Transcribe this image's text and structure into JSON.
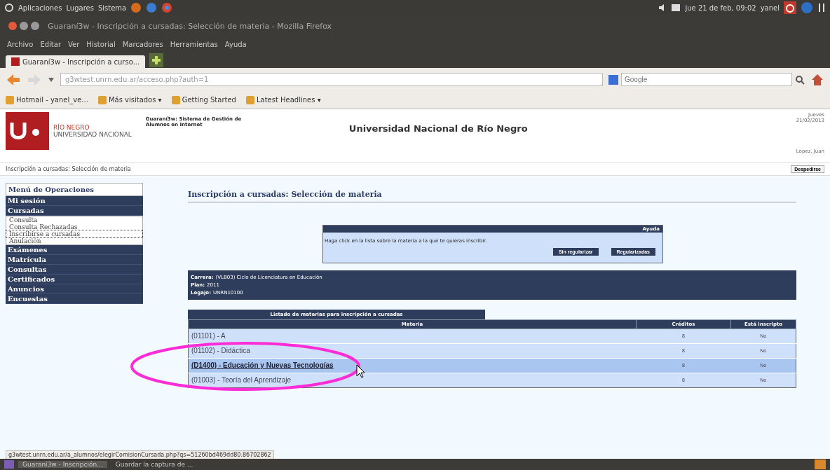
{
  "top_panel": {
    "menus": [
      "Aplicaciones",
      "Lugares",
      "Sistema"
    ],
    "datetime": "jue 21 de feb, 09:02",
    "user": "yanel"
  },
  "window": {
    "title": "Guaraní3w - Inscripción a cursadas: Selección de materia - Mozilla Firefox"
  },
  "menu_bar": [
    "Archivo",
    "Editar",
    "Ver",
    "Historial",
    "Marcadores",
    "Herramientas",
    "Ayuda"
  ],
  "tabs": [
    {
      "label": "Guaraní3w - Inscripción a curso...",
      "selected": true
    }
  ],
  "address_bar": {
    "value": "g3wtest.unrn.edu.ar/acceso.php?auth=1"
  },
  "search_bar": {
    "placeholder": "Google"
  },
  "bookmarks": [
    "Hotmail - yanel_ve...",
    "Más visitados ▾",
    "Getting Started",
    "Latest Headlines ▾"
  ],
  "header": {
    "logo_line1": "RÍO NEGRO",
    "logo_line2": "UNIVERSIDAD NACIONAL",
    "system_name": "Guaraní3w: Sistema de Gestión de Alumnos en Internet",
    "university": "Universidad Nacional de Río Negro",
    "date_day": "Jueves",
    "date": "21/02/2013",
    "user_name": "Lopez, Juan",
    "logout": "Despedirse"
  },
  "breadcrumb": "Inscripción a cursadas: Selección de materia",
  "sidebar": {
    "title": "Menú de Operaciones",
    "items": [
      {
        "label": "Mi sesión"
      },
      {
        "label": "Cursadas",
        "children": [
          {
            "label": "Consulta",
            "selected": false
          },
          {
            "label": "Consulta Rechazadas",
            "selected": false
          },
          {
            "label": "Inscribirse a cursadas",
            "selected": true
          },
          {
            "label": "Anulación",
            "selected": false
          }
        ]
      },
      {
        "label": "Exámenes"
      },
      {
        "label": "Matrícula"
      },
      {
        "label": "Consultas"
      },
      {
        "label": "Certificados"
      },
      {
        "label": "Anuncios"
      },
      {
        "label": "Encuestas"
      }
    ]
  },
  "page_title": "Inscripción a cursadas: Selección de materia",
  "help_box": {
    "title": "Ayuda",
    "text": "Haga click en la lista sobre la materia a la que te quieras inscribir.",
    "buttons": [
      "Sin regularizar",
      "Regularizadas"
    ]
  },
  "career_info": [
    {
      "label": "Carrera:",
      "value": "(VLB03) Ciclo de Licenciatura en Educación"
    },
    {
      "label": "Plan:",
      "value": "2011"
    },
    {
      "label": "Legajo:",
      "value": "UNRN10100"
    }
  ],
  "subjects_table": {
    "caption": "Listado de materias para inscripción a cursadas",
    "columns": [
      "Materia",
      "Créditos",
      "Está inscripto"
    ],
    "rows": [
      {
        "subject": "(01101) - A",
        "credits": "8",
        "enrolled": "No",
        "selected": false
      },
      {
        "subject": "(01102) - Didáctica",
        "credits": "8",
        "enrolled": "No",
        "selected": false
      },
      {
        "subject": "(D1400) - Educación y Nuevas Tecnologías",
        "credits": "8",
        "enrolled": "No",
        "selected": true
      },
      {
        "subject": "(01003) - Teoría del Aprendizaje",
        "credits": "8",
        "enrolled": "No",
        "selected": false
      }
    ]
  },
  "status_url": "g3wtest.unrn.edu.ar/a_alumnos/elegirComisionCursada.php?qs=51260bd469dd80.86702862",
  "taskbar": [
    "Guaraní3w - Inscripción...",
    "Guardar la captura de ..."
  ]
}
